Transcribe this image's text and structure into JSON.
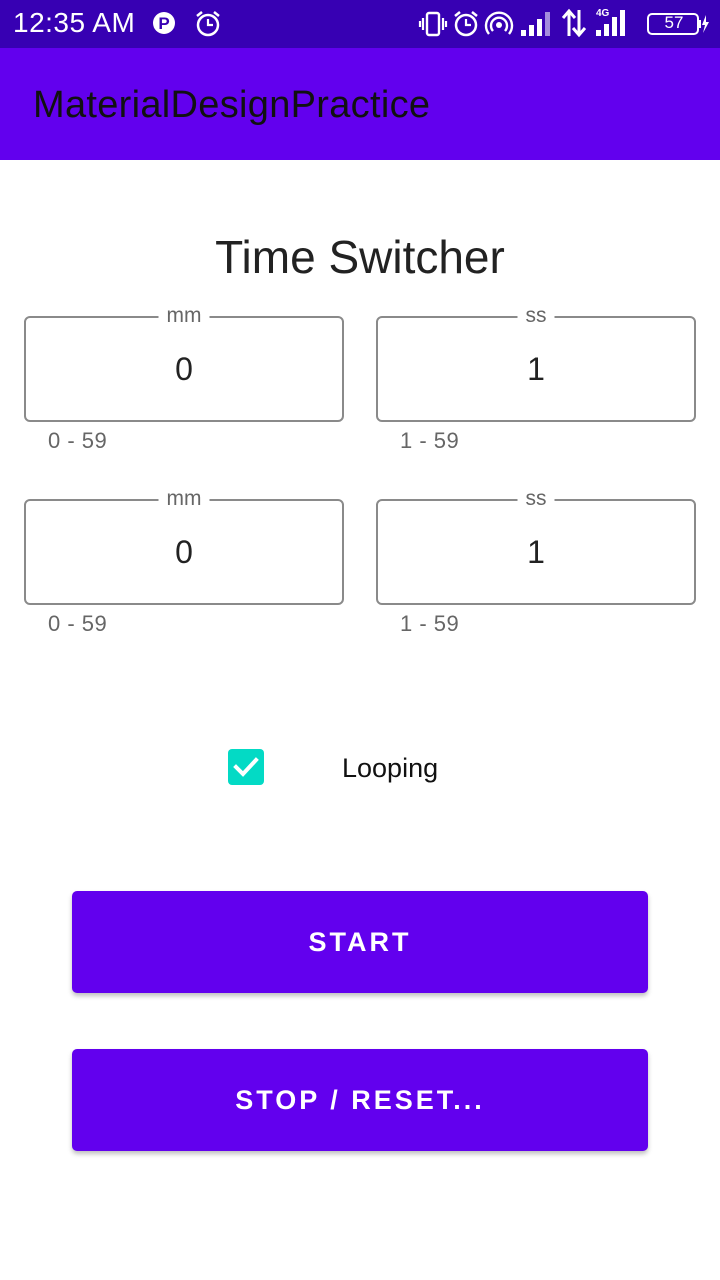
{
  "status_bar": {
    "time": "12:35 AM",
    "battery": "57",
    "network_type": "4G",
    "icons": [
      "parking-icon",
      "alarm-icon",
      "vibrate-icon",
      "alarm-icon",
      "hotspot-icon",
      "signal-icon",
      "data-transfer-icon",
      "signal-4g-icon",
      "battery-icon",
      "charging-icon"
    ]
  },
  "app_bar": {
    "title": "MaterialDesignPractice"
  },
  "main": {
    "title": "Time Switcher",
    "timers": [
      {
        "minutes": {
          "label": "mm",
          "value": "0",
          "helper": "0 - 59"
        },
        "seconds": {
          "label": "ss",
          "value": "1",
          "helper": "1 - 59"
        }
      },
      {
        "minutes": {
          "label": "mm",
          "value": "0",
          "helper": "0 - 59"
        },
        "seconds": {
          "label": "ss",
          "value": "1",
          "helper": "1 - 59"
        }
      }
    ],
    "looping": {
      "label": "Looping",
      "checked": true
    },
    "start_button": "START",
    "stop_button": "STOP / RESET..."
  },
  "colors": {
    "status_bar": "#3700b3",
    "primary": "#6200ee",
    "accent": "#03dac5"
  }
}
